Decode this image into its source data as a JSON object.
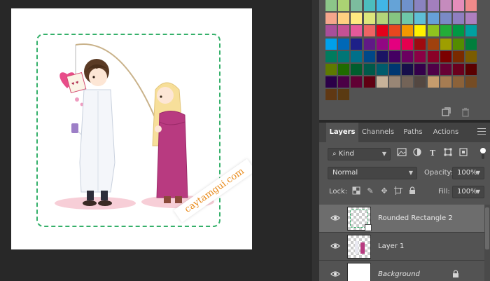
{
  "canvas": {
    "watermark_text": "caytamgui.com",
    "guide_color": "#35b06a",
    "illustration": "chibi-boy-in-lab-coat-fishing-with-heart-and-girl-in-pink-coat"
  },
  "swatches": {
    "rows": [
      [
        "#8cc689",
        "#abd373",
        "#7cbc9e",
        "#4cbdbe",
        "#41b6e6",
        "#65a3d7",
        "#6f92cb",
        "#8a83c0",
        "#a37fbd",
        "#c58bbd",
        "#e58dbb",
        "#f08a8a"
      ],
      [
        "#f5a68c",
        "#ffd080",
        "#ffe980",
        "#dde67c",
        "#b3d57a",
        "#86c581",
        "#6ec8a8",
        "#5ebfd6",
        "#66a0d8",
        "#7a8ac6",
        "#8f7fc0",
        "#ae7fbf"
      ],
      [
        "#a84e9a",
        "#c55194",
        "#e5599a",
        "#ec6464",
        "#e3001b",
        "#e8471f",
        "#f39800",
        "#fff100",
        "#8fc31f",
        "#22ac38",
        "#009944",
        "#00a0a0"
      ],
      [
        "#00a0e9",
        "#0068b7",
        "#1d2088",
        "#601986",
        "#920783",
        "#e4007f",
        "#e5004f",
        "#9e0b0f",
        "#a0410d",
        "#9e9e00",
        "#548c00",
        "#007e3c"
      ],
      [
        "#007b5e",
        "#007676",
        "#00708a",
        "#004888",
        "#1b1464",
        "#440062",
        "#6b0060",
        "#8a0045",
        "#8a0027",
        "#7b0000",
        "#7a2a00",
        "#7a5c00"
      ],
      [
        "#5e7a00",
        "#1f6b00",
        "#005d2e",
        "#00594a",
        "#005b6c",
        "#003771",
        "#170f4a",
        "#34004a",
        "#4f0048",
        "#670034",
        "#6a001d",
        "#5a0000"
      ],
      [
        "#2b0048",
        "#4b0046",
        "#610034",
        "#5f0012",
        "#c7b299",
        "#998675",
        "#736357",
        "#534741",
        "#c69c6d",
        "#a67c52",
        "#8c6239",
        "#754c24"
      ],
      [
        "#603813",
        "#5a3a12"
      ]
    ],
    "footer_icons": [
      "new-swatch-icon",
      "trash-icon"
    ]
  },
  "layers_panel": {
    "tabs": [
      {
        "label": "Layers",
        "active": true
      },
      {
        "label": "Channels",
        "active": false
      },
      {
        "label": "Paths",
        "active": false
      },
      {
        "label": "Actions",
        "active": false
      }
    ],
    "filter": {
      "label": "Kind",
      "icons": [
        "image-filter-icon",
        "adjustment-filter-icon",
        "type-filter-icon",
        "shape-filter-icon",
        "smart-object-filter-icon"
      ]
    },
    "blend_mode": "Normal",
    "opacity_label": "Opacity:",
    "opacity_value": "100%",
    "lock_label": "Lock:",
    "fill_label": "Fill:",
    "fill_value": "100%",
    "layers": [
      {
        "name": "Rounded Rectangle 2",
        "visible": true,
        "selected": true,
        "italic": false,
        "locked": false
      },
      {
        "name": "Layer 1",
        "visible": true,
        "selected": false,
        "italic": false,
        "locked": false
      },
      {
        "name": "Background",
        "visible": true,
        "selected": false,
        "italic": true,
        "locked": true
      }
    ]
  }
}
